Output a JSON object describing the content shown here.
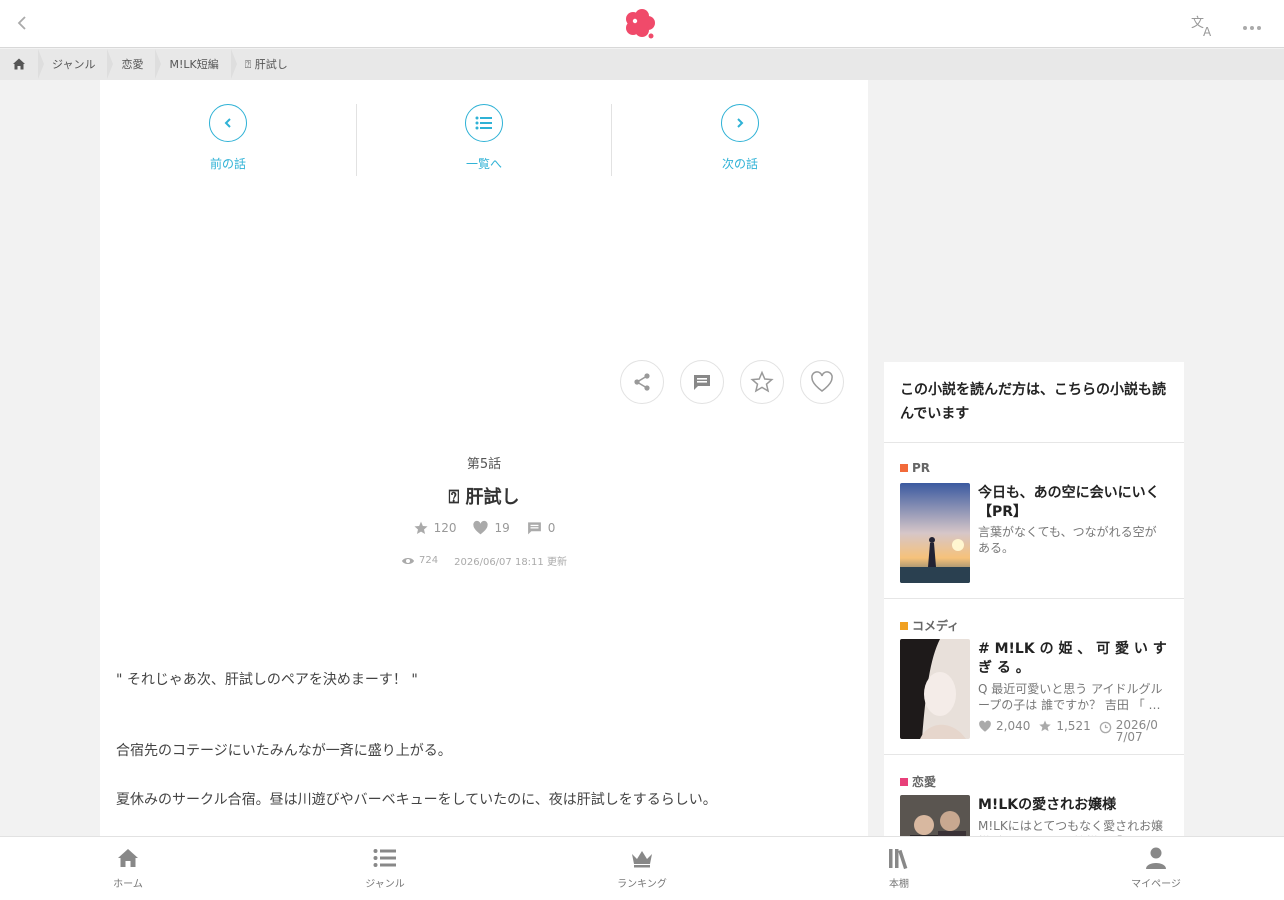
{
  "topbar": {
    "back_icon": "chevron-left-icon",
    "logo_icon": "flower-logo-icon",
    "translate_icon": "translate-icon",
    "more_icon": "more-horizontal-icon",
    "accent_color": "#f04a6a"
  },
  "breadcrumb": {
    "home_icon": "home-icon",
    "items": [
      "ジャンル",
      "恋愛",
      "M!LK短編",
      "⍰ 肝試し"
    ]
  },
  "episode_nav": {
    "prev_label": "前の話",
    "list_label": "一覧へ",
    "next_label": "次の話",
    "accent_color": "#2fb2d6"
  },
  "actions": {
    "share_icon": "share-icon",
    "comment_icon": "comment-icon",
    "star_icon": "star-outline-icon",
    "heart_icon": "heart-outline-icon"
  },
  "episode": {
    "number": "第5話",
    "title": "⍰ 肝試し",
    "stars": "120",
    "likes": "19",
    "comments": "0",
    "views": "724",
    "updated": "2026/06/07 18:11 更新"
  },
  "body": {
    "paragraphs": [
      "\" それじゃあ次、肝試しのペアを決めまーす！ \"",
      "合宿先のコテージにいたみんなが一斉に盛り上がる。",
      "夏休みのサークル合宿。昼は川遊びやバーベキューをしていたのに、夜は肝試しをするらしい。"
    ]
  },
  "sidebar": {
    "heading": "この小説を読んだ方は、こちらの小説も読んでいます",
    "items": [
      {
        "tag": "PR",
        "tag_color": "#f26a3a",
        "title": "今日も、あの空に会いにいく【PR】",
        "desc": "言葉がなくても、つながれる空がある。"
      },
      {
        "tag": "コメディ",
        "tag_color": "#f0a020",
        "title": "# M!LK の 姫 、 可 愛 い す ぎ る 。",
        "desc": "Q 最近可愛いと思う アイドルグループの子は 誰ですか？ 吉田 「 …",
        "likes": "2,040",
        "stars": "1,521",
        "date": "2026/07/07"
      },
      {
        "tag": "恋愛",
        "tag_color": "#e8407a",
        "title": "M!LKの愛されお嬢様",
        "desc": "M!LKにはとてつもなく愛されお嬢様がいる。そのお嬢様は「〇〇〇」"
      }
    ]
  },
  "bottom_nav": {
    "home": "ホーム",
    "genre": "ジャンル",
    "ranking": "ランキング",
    "shelf": "本棚",
    "mypage": "マイページ"
  }
}
